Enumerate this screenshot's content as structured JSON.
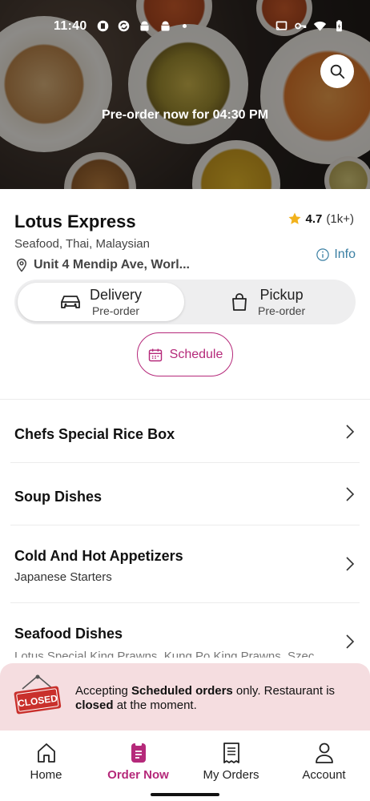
{
  "status_bar": {
    "time": "11:40",
    "left_icons": [
      "chat-bubble-icon",
      "sync-icon",
      "android-icon",
      "android-icon",
      "dot-icon"
    ],
    "right_icons": [
      "cast-icon",
      "key-icon",
      "wifi-icon",
      "battery-charging-icon"
    ]
  },
  "hero": {
    "caption": "Pre-order now for 04:30 PM",
    "search_icon": "search-icon"
  },
  "restaurant": {
    "name": "Lotus Express",
    "rating": "4.7",
    "rating_count": "(1k+)",
    "cuisines": "Seafood, Thai, Malaysian",
    "address": "Unit 4 Mendip Ave, Worl...",
    "info_label": "Info"
  },
  "order_mode": {
    "delivery": {
      "label": "Delivery",
      "sub": "Pre-order",
      "selected": true
    },
    "pickup": {
      "label": "Pickup",
      "sub": "Pre-order",
      "selected": false
    }
  },
  "schedule": {
    "label": "Schedule"
  },
  "menu": [
    {
      "title": "Chefs Special Rice Box",
      "subtitle": ""
    },
    {
      "title": "Soup Dishes",
      "subtitle": ""
    },
    {
      "title": "Cold And Hot Appetizers",
      "subtitle": "Japanese Starters"
    },
    {
      "title": "Seafood Dishes",
      "subtitle": "Lotus Special King Prawns, Kung Po King Prawns, Szec"
    }
  ],
  "closed_banner": {
    "sign_text": "CLOSED",
    "text_1": "Accepting ",
    "text_bold_1": "Scheduled orders",
    "text_2": " only. Restaurant is ",
    "text_bold_2": "closed",
    "text_3": " at the moment."
  },
  "bottom_nav": [
    {
      "label": "Home",
      "icon": "home-icon",
      "active": false
    },
    {
      "label": "Order Now",
      "icon": "order-icon",
      "active": true
    },
    {
      "label": "My Orders",
      "icon": "receipt-icon",
      "active": false
    },
    {
      "label": "Account",
      "icon": "person-icon",
      "active": false
    }
  ],
  "colors": {
    "accent": "#b5297a",
    "info_link": "#3a7fa3",
    "star": "#f2b21c",
    "closed_banner_bg": "#f5dde0",
    "closed_sign": "#c9302c"
  }
}
